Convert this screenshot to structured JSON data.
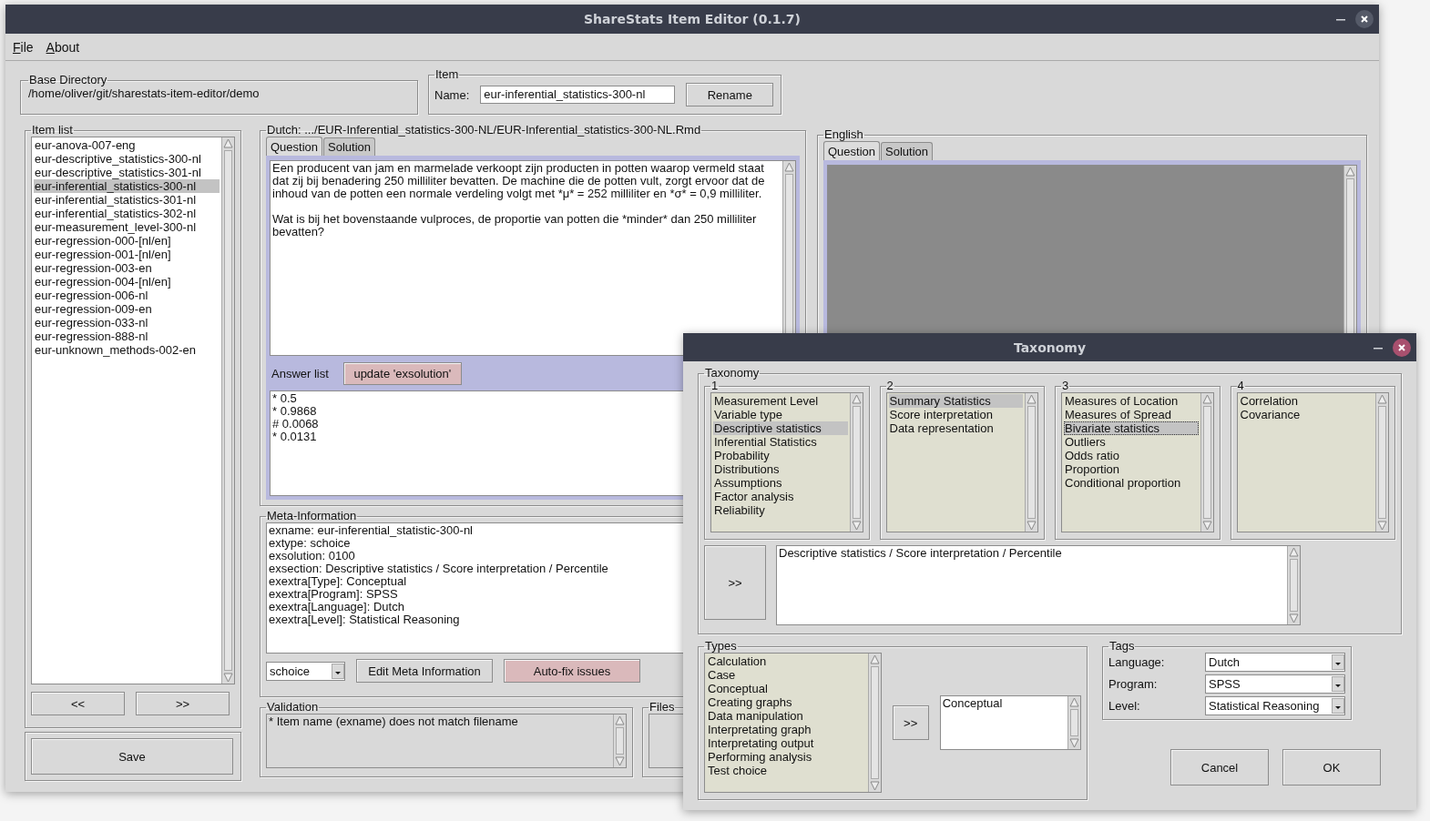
{
  "window": {
    "title": "ShareStats Item Editor (0.1.7)"
  },
  "menu": [
    {
      "label": "File"
    },
    {
      "label": "About"
    }
  ],
  "base_directory": {
    "label": "Base Directory",
    "path": "/home/oliver/git/sharestats-item-editor/demo"
  },
  "item": {
    "label": "Item",
    "name_label": "Name:",
    "name_value": "eur-inferential_statistics-300-nl",
    "rename_button": "Rename"
  },
  "item_list": {
    "label": "Item list",
    "items": [
      {
        "label": "eur-anova-007-eng",
        "selected": false
      },
      {
        "label": "eur-descriptive_statistics-300-nl",
        "selected": false
      },
      {
        "label": "eur-descriptive_statistics-301-nl",
        "selected": false
      },
      {
        "label": "eur-inferential_statistics-300-nl",
        "selected": true
      },
      {
        "label": "eur-inferential_statistics-301-nl",
        "selected": false
      },
      {
        "label": "eur-inferential_statistics-302-nl",
        "selected": false
      },
      {
        "label": "eur-measurement_level-300-nl",
        "selected": false
      },
      {
        "label": "eur-regression-000-[nl/en]",
        "selected": false
      },
      {
        "label": "eur-regression-001-[nl/en]",
        "selected": false
      },
      {
        "label": "eur-regression-003-en",
        "selected": false
      },
      {
        "label": "eur-regression-004-[nl/en]",
        "selected": false
      },
      {
        "label": "eur-regression-006-nl",
        "selected": false
      },
      {
        "label": "eur-regression-009-en",
        "selected": false
      },
      {
        "label": "eur-regression-033-nl",
        "selected": false
      },
      {
        "label": "eur-regression-888-nl",
        "selected": false
      },
      {
        "label": "eur-unknown_methods-002-en",
        "selected": false
      }
    ],
    "prev_button": "<<",
    "next_button": ">>"
  },
  "save_button": "Save",
  "dutch": {
    "label": "Dutch:  .../EUR-Inferential_statistics-300-NL/EUR-Inferential_statistics-300-NL.Rmd",
    "tabs": [
      {
        "label": "Question",
        "selected": true
      },
      {
        "label": "Solution",
        "selected": false
      }
    ],
    "question": [
      "Een producent van jam en marmelade verkoopt zijn producten in potten waarop vermeld staat dat zij bij benadering 250 milliliter bevatten. De machine die de potten vult, zorgt ervoor dat de inhoud van de potten een normale verdeling volgt met *μ* = 252 milliliter en *σ* = 0,9 milliliter.",
      "Wat is bij het bovenstaande vulproces, de proportie van potten die *minder* dan 250 milliliter bevatten?"
    ],
    "answer_list": {
      "label": "Answer list",
      "button": {
        "label": "update 'exsolution'",
        "highlighted": true
      },
      "answers": [
        "* 0.5",
        "* 0.9868",
        "# 0.0068",
        "* 0.0131"
      ]
    }
  },
  "meta": {
    "label": "Meta-Information",
    "lines": [
      "exname: eur-inferential_statistic-300-nl",
      "extype: schoice",
      "exsolution: 0100",
      "exsection: Descriptive statistics / Score interpretation / Percentile",
      "exextra[Type]: Conceptual",
      "exextra[Program]: SPSS",
      "exextra[Language]: Dutch",
      "exextra[Level]: Statistical Reasoning"
    ],
    "type_select": "schoice",
    "buttons": [
      {
        "label": "Edit Meta Information",
        "highlighted": false
      },
      {
        "label": "Auto-fix issues",
        "highlighted": true
      }
    ]
  },
  "validation": {
    "label": "Validation",
    "messages": [
      "* Item name (exname) does not match filename"
    ]
  },
  "files": {
    "label": "Files"
  },
  "english": {
    "label": "English",
    "tabs": [
      {
        "label": "Question",
        "selected": true
      },
      {
        "label": "Solution",
        "selected": false
      }
    ],
    "editor": {
      "disabled": true
    }
  },
  "taxonomy_dialog": {
    "title": "Taxonomy",
    "taxonomy": {
      "label": "Taxonomy",
      "levels": [
        {
          "label": "1",
          "items": [
            {
              "label": "Measurement Level",
              "selected": false
            },
            {
              "label": "Variable type",
              "selected": false
            },
            {
              "label": "Descriptive statistics",
              "selected": true
            },
            {
              "label": "Inferential Statistics",
              "selected": false
            },
            {
              "label": "Probability",
              "selected": false
            },
            {
              "label": "Distributions",
              "selected": false
            },
            {
              "label": "Assumptions",
              "selected": false
            },
            {
              "label": "Factor analysis",
              "selected": false
            },
            {
              "label": "Reliability",
              "selected": false
            }
          ]
        },
        {
          "label": "2",
          "items": [
            {
              "label": "Summary Statistics",
              "selected": true
            },
            {
              "label": "Score interpretation",
              "selected": false
            },
            {
              "label": "Data representation",
              "selected": false
            }
          ]
        },
        {
          "label": "3",
          "items": [
            {
              "label": "Measures of Location",
              "selected": false
            },
            {
              "label": "Measures of Spread",
              "selected": false
            },
            {
              "label": "Bivariate statistics",
              "selected": true
            },
            {
              "label": "Outliers",
              "selected": false
            },
            {
              "label": "Odds ratio",
              "selected": false
            },
            {
              "label": "Proportion",
              "selected": false
            },
            {
              "label": "Conditional proportion",
              "selected": false
            }
          ]
        },
        {
          "label": "4",
          "items": [
            {
              "label": "Correlation",
              "selected": false
            },
            {
              "label": "Covariance",
              "selected": false
            }
          ]
        }
      ],
      "add_button": ">>",
      "selection": "Descriptive statistics / Score interpretation / Percentile"
    },
    "types": {
      "label": "Types",
      "items": [
        {
          "label": "Calculation",
          "selected": false
        },
        {
          "label": "Case",
          "selected": false
        },
        {
          "label": "Conceptual",
          "selected": false
        },
        {
          "label": "Creating graphs",
          "selected": false
        },
        {
          "label": "Data manipulation",
          "selected": false
        },
        {
          "label": "Interpretating graph",
          "selected": false
        },
        {
          "label": "Interpretating output",
          "selected": false
        },
        {
          "label": "Performing analysis",
          "selected": false
        },
        {
          "label": "Test choice",
          "selected": false
        }
      ],
      "add_button": ">>",
      "chosen": [
        "Conceptual"
      ]
    },
    "tags": {
      "label": "Tags",
      "fields": [
        {
          "label": "Language:",
          "value": "Dutch"
        },
        {
          "label": "Program:",
          "value": "SPSS"
        },
        {
          "label": "Level:",
          "value": "Statistical Reasoning"
        }
      ]
    },
    "buttons": [
      "Cancel",
      "OK"
    ]
  }
}
